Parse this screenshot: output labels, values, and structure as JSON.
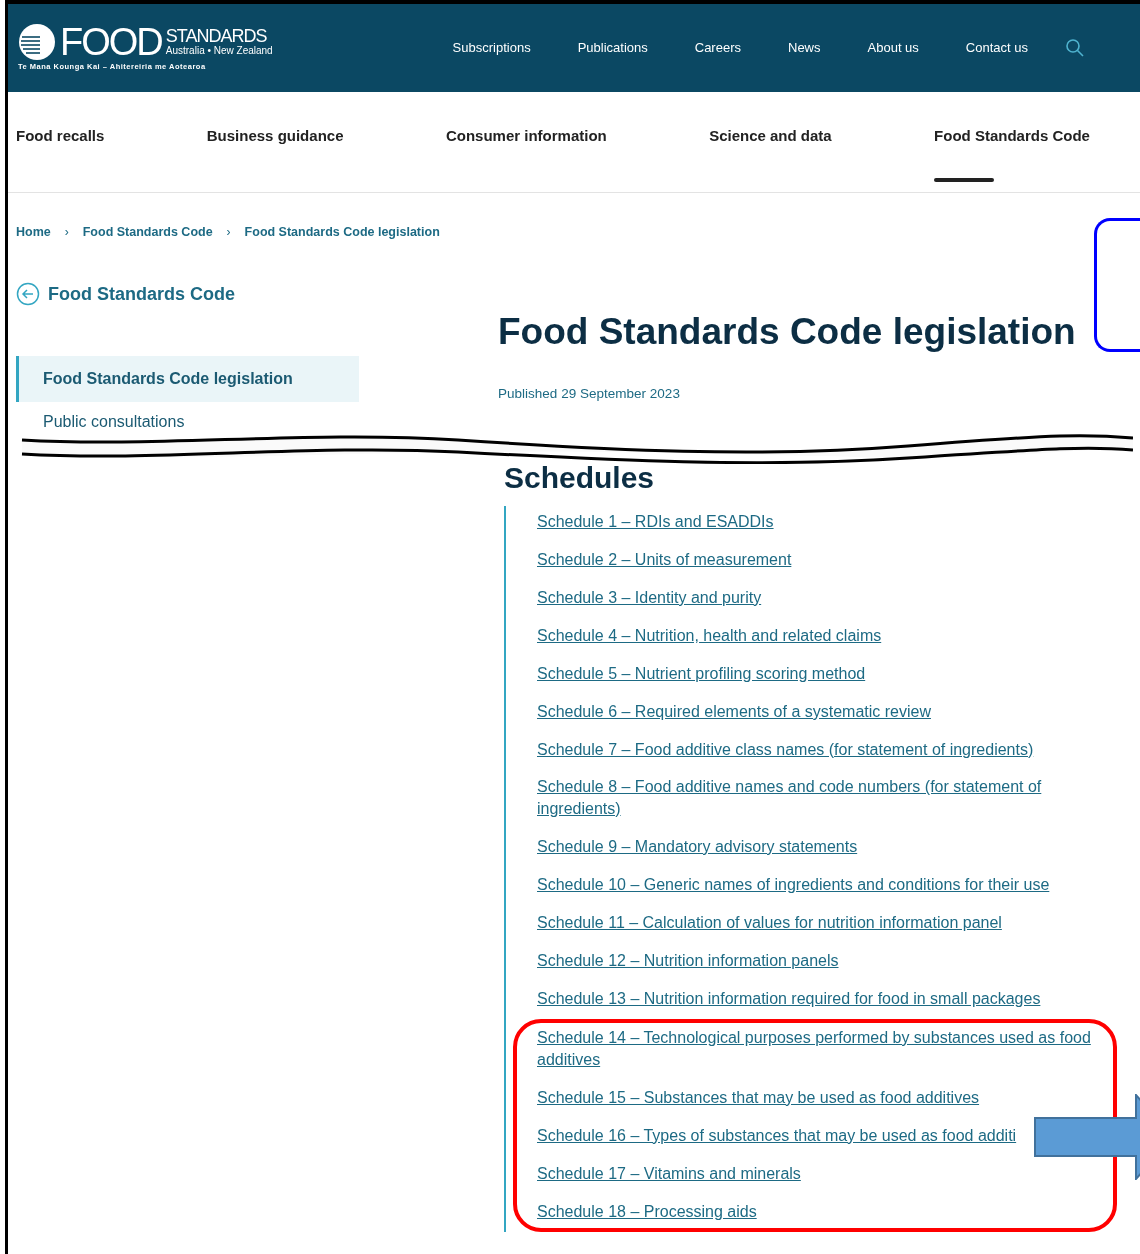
{
  "logo": {
    "wordmark": "FOOD",
    "suffix": "STANDARDS",
    "region": "Australia • New Zealand",
    "tagline": "Te Mana Kounga Kai – Ahitereiria me Aotearoa"
  },
  "top_nav": [
    "Subscriptions",
    "Publications",
    "Careers",
    "News",
    "About us",
    "Contact us"
  ],
  "main_nav": [
    {
      "label": "Food recalls",
      "selected": false
    },
    {
      "label": "Business guidance",
      "selected": false
    },
    {
      "label": "Consumer information",
      "selected": false
    },
    {
      "label": "Science and data",
      "selected": false
    },
    {
      "label": "Food Standards Code",
      "selected": true
    }
  ],
  "breadcrumb": [
    {
      "label": "Home"
    },
    {
      "separator": "›",
      "label": "Food Standards Code"
    },
    {
      "separator": "›",
      "label": "Food Standards Code legislation"
    }
  ],
  "sidebar": {
    "back_link": "Food Standards Code",
    "items": [
      {
        "label": "Food Standards Code legislation",
        "selected": true
      },
      {
        "label": "Public consultations",
        "selected": false
      }
    ]
  },
  "page": {
    "title": "Food Standards Code legislation",
    "published_label": "Published",
    "published_date": "29 September 2023",
    "section_heading": "Schedules",
    "schedule_groups": [
      {
        "highlighted": false,
        "items": [
          "Schedule 1 – RDIs and ESADDIs",
          "Schedule 2 – Units of measurement",
          "Schedule 3 – Identity and purity",
          "Schedule 4 – Nutrition, health and related claims",
          "Schedule 5 – Nutrient profiling scoring method",
          "Schedule 6 – Required elements of a systematic review",
          "Schedule 7 – Food additive class names (for statement of ingredients)",
          "Schedule 8 – Food additive names and code numbers (for statement of ingredients)",
          "Schedule 9 – Mandatory advisory statements",
          "Schedule 10 – Generic names of ingredients and conditions for their use",
          "Schedule 11 – Calculation of values for nutrition information panel",
          "Schedule 12 – Nutrition information panels",
          "Schedule 13 – Nutrition information required for food in small packages"
        ]
      },
      {
        "highlighted": true,
        "items": [
          "Schedule 14 – Technological purposes performed by substances used as food additives",
          "Schedule 15 – Substances that may be used as food additives",
          "Schedule 16 – Types of substances that may be used as food additi",
          "Schedule 17 – Vitamins and minerals",
          "Schedule 18 – Processing aids"
        ]
      }
    ]
  },
  "annotations": [
    {
      "kind": "frame",
      "color": "#0000ff"
    },
    {
      "kind": "highlight",
      "color": "#ff0000"
    },
    {
      "kind": "arrow",
      "color": "#5b9bd5"
    },
    {
      "kind": "break"
    }
  ]
}
